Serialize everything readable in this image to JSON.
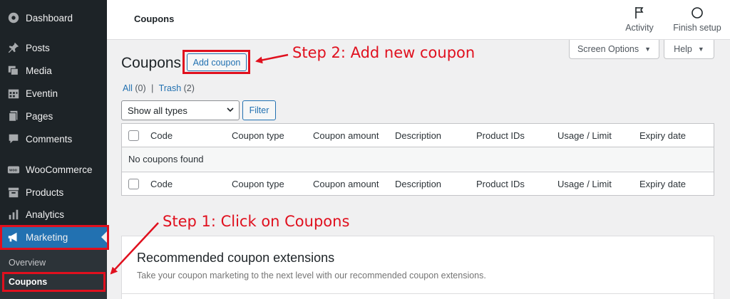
{
  "sidebar": {
    "items": [
      {
        "label": "Dashboard",
        "icon": "dashboard-icon"
      },
      {
        "label": "Posts",
        "icon": "pin-icon"
      },
      {
        "label": "Media",
        "icon": "media-icon"
      },
      {
        "label": "Eventin",
        "icon": "calendar-icon"
      },
      {
        "label": "Pages",
        "icon": "pages-icon"
      },
      {
        "label": "Comments",
        "icon": "comment-icon"
      },
      {
        "label": "WooCommerce",
        "icon": "woo-icon"
      },
      {
        "label": "Products",
        "icon": "archive-icon"
      },
      {
        "label": "Analytics",
        "icon": "bar-chart-icon"
      },
      {
        "label": "Marketing",
        "icon": "megaphone-icon"
      }
    ],
    "submenu": [
      {
        "label": "Overview"
      },
      {
        "label": "Coupons"
      }
    ]
  },
  "topbar": {
    "title": "Coupons",
    "activity_label": "Activity",
    "finish_setup_label": "Finish setup"
  },
  "tabs": {
    "screen_options": "Screen Options",
    "help": "Help"
  },
  "page": {
    "title": "Coupons",
    "add_button": "Add coupon"
  },
  "views": {
    "all": "All",
    "all_count": "(0)",
    "separator": "|",
    "trash": "Trash",
    "trash_count": "(2)"
  },
  "filters": {
    "type_selected": "Show all types",
    "filter_button": "Filter"
  },
  "table": {
    "columns": [
      "Code",
      "Coupon type",
      "Coupon amount",
      "Description",
      "Product IDs",
      "Usage / Limit",
      "Expiry date"
    ],
    "empty_message": "No coupons found"
  },
  "card": {
    "title": "Recommended coupon extensions",
    "description": "Take your coupon marketing to the next level with our recommended coupon extensions."
  },
  "annotations": {
    "step1": "Step 1: Click on Coupons",
    "step2": "Step 2: Add new coupon",
    "color": "#e0101e"
  },
  "colors": {
    "sidebar_bg": "#1d2327",
    "accent": "#2271b1"
  }
}
